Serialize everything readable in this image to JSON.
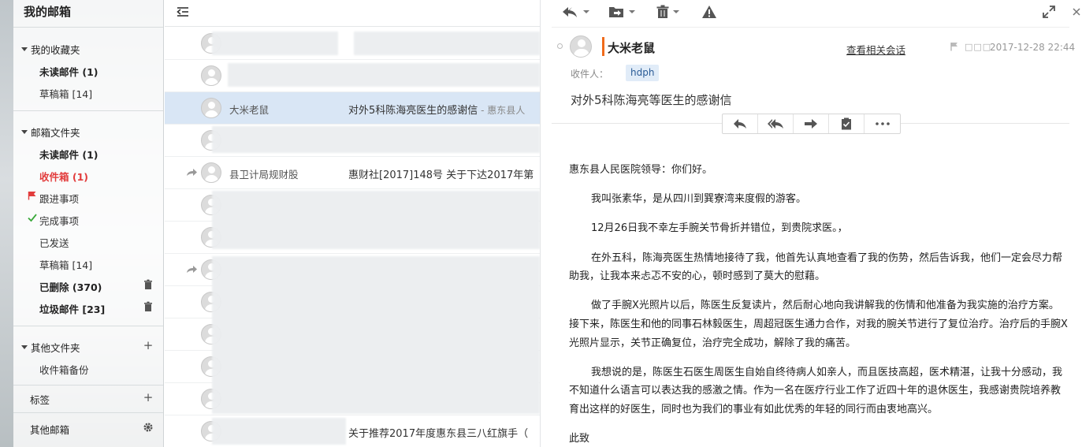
{
  "sidebar": {
    "title": "我的邮箱",
    "favorites": {
      "label": "我的收藏夹",
      "items": [
        {
          "label": "未读邮件 (1)"
        },
        {
          "label": "草稿箱 [14]"
        }
      ]
    },
    "folders": {
      "label": "邮箱文件夹",
      "items": [
        {
          "label": "未读邮件 (1)"
        },
        {
          "label": "收件箱 (1)"
        },
        {
          "label": "跟进事项"
        },
        {
          "label": "完成事项"
        },
        {
          "label": "已发送"
        },
        {
          "label": "草稿箱 [14]"
        },
        {
          "label": "已删除 (370)"
        },
        {
          "label": "垃圾邮件 [23]"
        }
      ]
    },
    "other_folders": {
      "label": "其他文件夹",
      "items": [
        {
          "label": "收件箱备份"
        }
      ]
    },
    "tags": {
      "label": "标签"
    },
    "other_mail": {
      "label": "其他邮箱"
    }
  },
  "list": {
    "rows": [
      {
        "sender": "",
        "subject": "",
        "snippet": ""
      },
      {
        "sender": "大米老鼠",
        "subject": "对外5科陈海亮医生的感谢信",
        "snippet": " - 惠东县人"
      },
      {
        "sender": "",
        "subject": "",
        "snippet": ""
      },
      {
        "sender": "县卫计局规财股",
        "subject": "惠财社[2017]148号 关于下达2017年第",
        "snippet": ""
      },
      {
        "sender": "",
        "subject": "",
        "snippet": ""
      },
      {
        "sender": "",
        "subject": "",
        "snippet": ""
      },
      {
        "sender": "",
        "subject": "",
        "snippet": ""
      },
      {
        "sender": "",
        "subject": "",
        "snippet": ""
      },
      {
        "sender": "",
        "subject": "",
        "snippet": ""
      },
      {
        "sender": "",
        "subject": "",
        "snippet": ""
      },
      {
        "sender": "",
        "subject": "",
        "snippet": ""
      },
      {
        "sender": "",
        "subject": "关于推荐2017年度惠东县三八红旗手（",
        "snippet": ""
      },
      {
        "sender": "",
        "subject": "",
        "snippet": ""
      }
    ]
  },
  "reader": {
    "sender_name": "大米老鼠",
    "related_link": "查看相关会话",
    "boxes": "□□□",
    "datetime": "2017-12-28 22:44",
    "recipient_label": "收件人：",
    "recipient": "hdph",
    "subject": "对外5科陈海亮等医生的感谢信",
    "body": [
      "惠东县人民医院领导：你们好。",
      "我叫张素华，是从四川到巽寮湾来度假的游客。",
      "12月26日我不幸左手腕关节骨折并错位，到贵院求医。，",
      "在外五科，陈海亮医生热情地接待了我，他首先认真地查看了我的伤势，然后告诉我，他们一定会尽力帮助我，让我本来忐忑不安的心，顿时感到了莫大的慰藉。",
      "做了手腕X光照片以后，陈医生反复读片，然后耐心地向我讲解我的伤情和他准备为我实施的治疗方案。接下来，陈医生和他的同事石林毅医生，周超冠医生通力合作，对我的腕关节进行了复位治疗。治疗后的手腕X光照片显示，关节正确复位，治疗完全成功，解除了我的痛苦。",
      "我想说的是，陈医生石医生周医生自始自终待病人如亲人，而且医技高超，医术精湛，让我十分感动，我不知道什么语言可以表达我的感激之情。作为一名在医疗行业工作了近四十年的退休医生，我感谢贵院培养教育出这样的好医生，同时也为我们的事业有如此优秀的年轻的同行而由衷地高兴。",
      "此致"
    ]
  },
  "colors": {
    "accent_red": "#e23c3c",
    "orange": "#f06b1b",
    "selected_row": "#d9e6f5",
    "chip_bg": "#e1ecf8"
  }
}
